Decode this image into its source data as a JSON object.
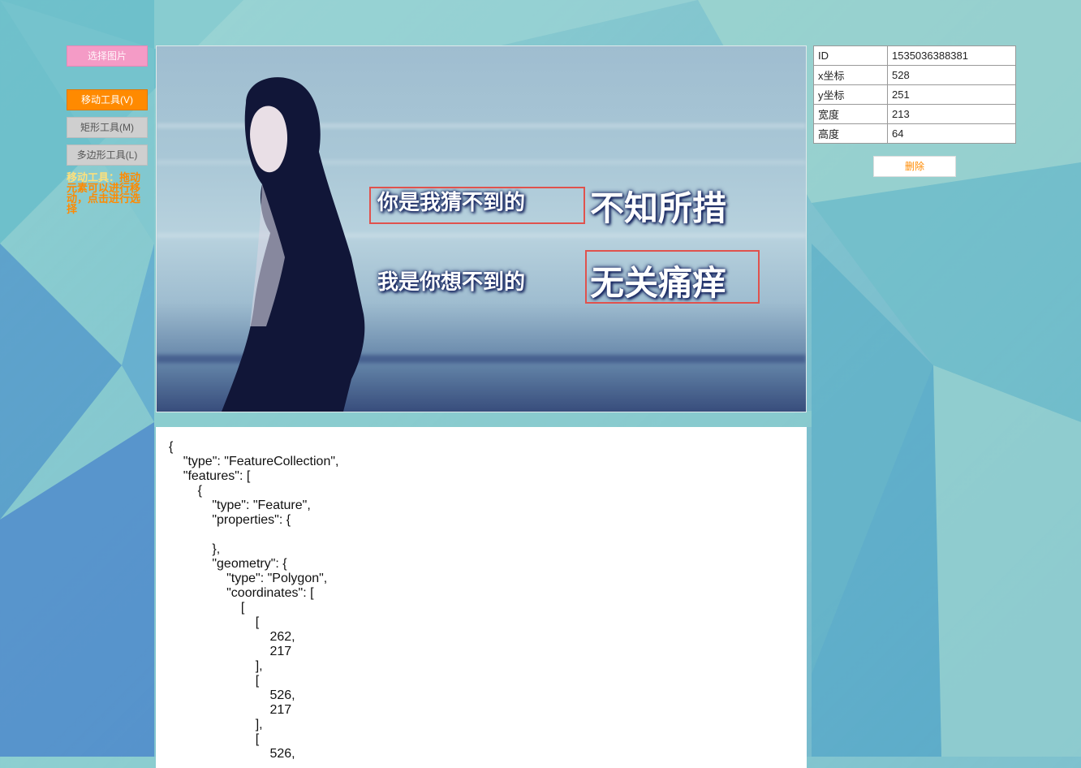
{
  "toolbar": {
    "select_image_label": "选择图片",
    "tools": [
      {
        "label": "移动工具(V)",
        "active": true
      },
      {
        "label": "矩形工具(M)",
        "active": false
      },
      {
        "label": "多边形工具(L)",
        "active": false
      }
    ],
    "hint_title": "移动工具：",
    "hint_body": "拖动元素可以进行移动，点击进行选择"
  },
  "canvas": {
    "caption_line1_a": "你是我猜不到的",
    "caption_line1_b": "不知所措",
    "caption_line2_a": "我是你想不到的",
    "caption_line2_b": "无关痛痒"
  },
  "properties": {
    "rows": [
      {
        "key": "ID",
        "value": "1535036388381"
      },
      {
        "key": "x坐标",
        "value": "528"
      },
      {
        "key": "y坐标",
        "value": "251"
      },
      {
        "key": "宽度",
        "value": "213"
      },
      {
        "key": "高度",
        "value": "64"
      }
    ],
    "delete_label": "删除"
  },
  "geojson_text": "{\n    \"type\": \"FeatureCollection\",\n    \"features\": [\n        {\n            \"type\": \"Feature\",\n            \"properties\": {\n\n            },\n            \"geometry\": {\n                \"type\": \"Polygon\",\n                \"coordinates\": [\n                    [\n                        [\n                            262,\n                            217\n                        ],\n                        [\n                            526,\n                            217\n                        ],\n                        [\n                            526,",
  "colors": {
    "accent": "#ff8a00",
    "select_button": "#f49bc6",
    "selection_box": "#e0524d"
  }
}
